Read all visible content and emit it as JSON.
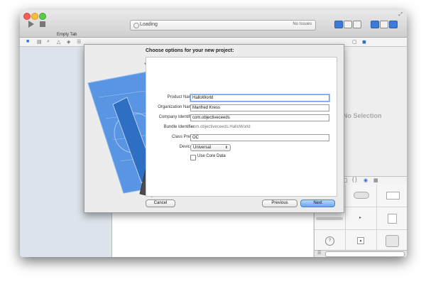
{
  "toolbar": {
    "scheme": "Empty Tab",
    "activity_status": "Loading",
    "issues": "No Issues"
  },
  "inspector": {
    "empty_state": "No Selection"
  },
  "sheet": {
    "title": "Choose options for your new project:",
    "fields": {
      "product_name": {
        "label": "Product Name",
        "value": "HalloWorld"
      },
      "organization_name": {
        "label": "Organization Name",
        "value": "Manfred Kress"
      },
      "company_identifier": {
        "label": "Company Identifier",
        "value": "com.objectiveceeds"
      },
      "bundle_identifier": {
        "label": "Bundle Identifier",
        "value": "com.objectiveceeds.HalloWorld"
      },
      "class_prefix": {
        "label": "Class Prefix",
        "value": "OC"
      },
      "devices": {
        "label": "Devices",
        "value": "Universal"
      }
    },
    "use_core_data": {
      "label": "Use Core Data",
      "checked": false
    },
    "buttons": {
      "cancel": "Cancel",
      "previous": "Previous",
      "next": "Next"
    }
  },
  "icons": [
    "play-icon",
    "stop-icon",
    "folder-icon",
    "search-icon",
    "gear-icon",
    "file-icon",
    "braces-icon",
    "library-icon"
  ],
  "colors": {
    "accent": "#3b7ad8",
    "focus_ring": "#6fa0e6",
    "default_button": "#6aa5ef",
    "blueprint": "#3f86e0"
  }
}
